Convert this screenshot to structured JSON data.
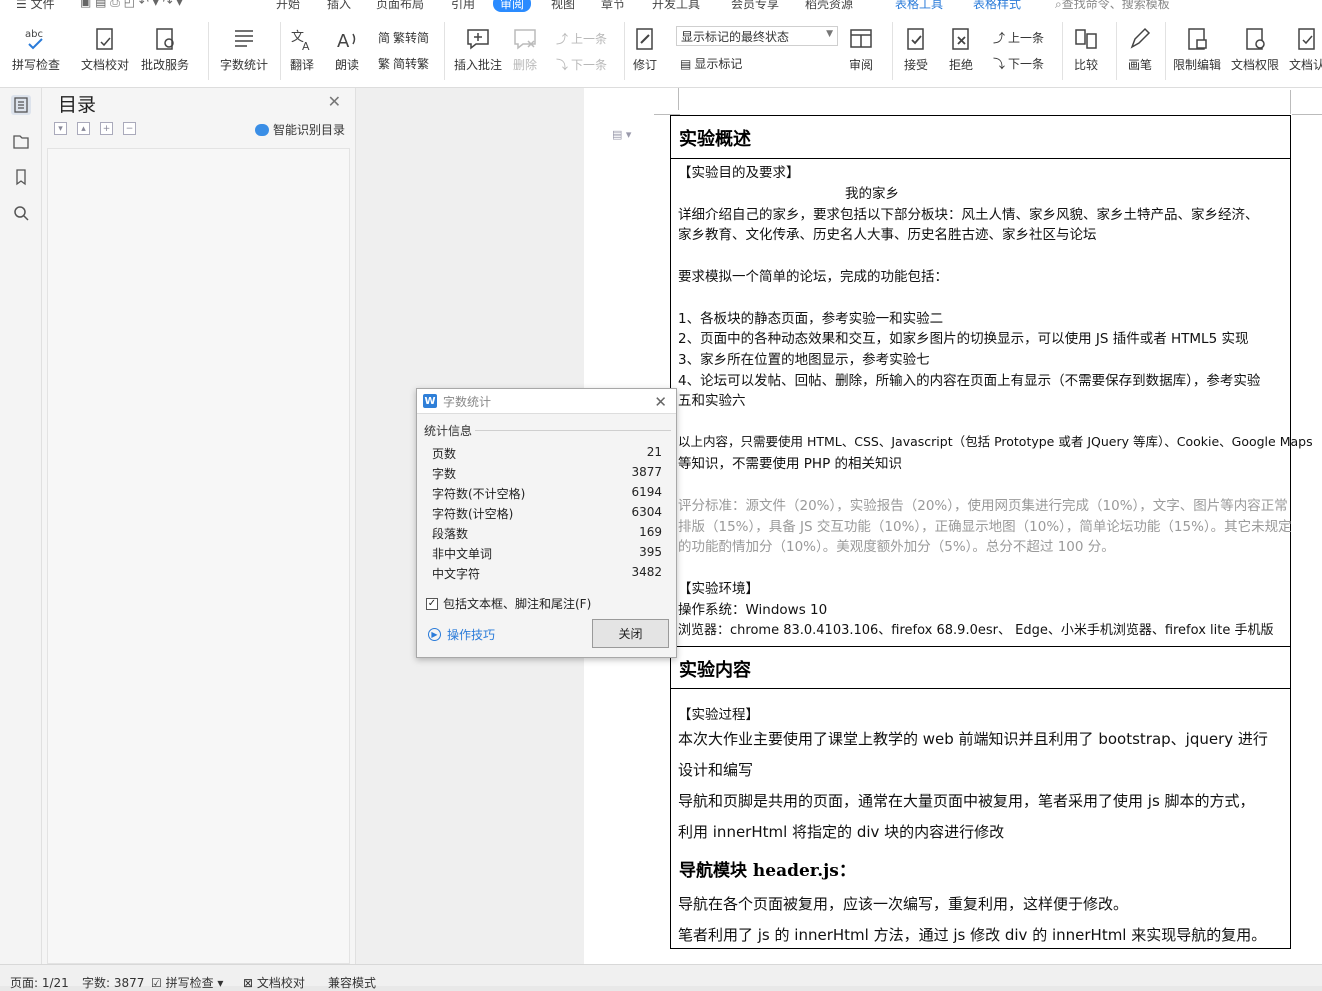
{
  "menubar": {
    "file_label": "文件",
    "tabs": [
      "开始",
      "插入",
      "页面布局",
      "引用",
      "审阅",
      "视图",
      "章节",
      "开发工具",
      "会员专享",
      "稻壳资源",
      "表格工具",
      "表格样式"
    ],
    "active_tab": "审阅",
    "search_placeholder": "查找命令、搜索模板"
  },
  "ribbon": {
    "spell_check": "拼写检查",
    "doc_proof": "文档校对",
    "revise_service": "批改服务",
    "word_count": "字数统计",
    "translate": "翻译",
    "read_aloud": "朗读",
    "trad_to_simp": "繁转简",
    "simp_to_trad": "简转繁",
    "insert_comment": "插入批注",
    "delete": "删除",
    "prev_comment": "上一条",
    "next_comment": "下一条",
    "track_changes": "修订",
    "markup_select": "显示标记的最终状态",
    "show_markup": "显示标记",
    "review": "审阅",
    "accept": "接受",
    "reject": "拒绝",
    "prev_change": "上一条",
    "next_change": "下一条",
    "compare": "比较",
    "pen": "画笔",
    "restrict_edit": "限制编辑",
    "doc_permission": "文档权限",
    "doc_more": "文档认"
  },
  "toc": {
    "title": "目录",
    "smart_label": "智能识别目录"
  },
  "document": {
    "section1_title": "实验概述",
    "purpose_heading": "【实验目的及要求】",
    "topic": "我的家乡",
    "line1": "详细介绍自己的家乡，要求包括以下部分板块：风土人情、家乡风貌、家乡土特产品、家乡经济、",
    "line2": "家乡教育、文化传承、历史名人大事、历史名胜古迹、家乡社区与论坛",
    "line3": "要求模拟一个简单的论坛，完成的功能包括：",
    "item1": "1、各板块的静态页面，参考实验一和实验二",
    "item2": "2、页面中的各种动态效果和交互，如家乡图片的切换显示，可以使用 JS 插件或者 HTML5 实现",
    "item3": "3、家乡所在位置的地图显示，参考实验七",
    "item4": "4、论坛可以发帖、回帖、删除，所输入的内容在页面上有显示（不需要保存到数据库），参考实验",
    "item4b": "五和实验六",
    "tech1": "以上内容，只需要使用 HTML、CSS、Javascript（包括 Prototype 或者 JQuery 等库）、Cookie、Google Maps",
    "tech2": "等知识，不需要使用 PHP 的相关知识",
    "score1": "评分标准：源文件（20%），实验报告（20%），使用网页集进行完成（10%），文字、图片等内容正常",
    "score2": "排版（15%），具备 JS 交互功能（10%），正确显示地图（10%），简单论坛功能（15%）。其它未规定",
    "score3": "的功能酌情加分（10%）。美观度额外加分（5%）。总分不超过 100 分。",
    "env_heading": "【实验环境】",
    "os": "操作系统：Windows 10",
    "browser": "浏览器：chrome 83.0.4103.106、firefox 68.9.0esr、 Edge、小米手机浏览器、firefox lite 手机版",
    "section2_title": "实验内容",
    "process_heading": "【实验过程】",
    "p1a": "本次大作业主要使用了课堂上教学的 web 前端知识并且利用了 bootstrap、jquery 进行",
    "p1b": "设计和编写",
    "p2a": "导航和页脚是共用的页面，通常在大量页面中被复用，笔者采用了使用 js 脚本的方式，",
    "p2b": "利用 innerHtml 将指定的 div 块的内容进行修改",
    "nav_heading": "导航模块 header.js：",
    "p3": "导航在各个页面被复用，应该一次编写，重复利用，这样便于修改。",
    "p4": "笔者利用了 js 的 innerHtml 方法，通过 js 修改 div 的 innerHtml 来实现导航的复用。"
  },
  "dialog": {
    "title": "字数统计",
    "section": "统计信息",
    "rows": [
      {
        "label": "页数",
        "value": "21"
      },
      {
        "label": "字数",
        "value": "3877"
      },
      {
        "label": "字符数(不计空格)",
        "value": "6194"
      },
      {
        "label": "字符数(计空格)",
        "value": "6304"
      },
      {
        "label": "段落数",
        "value": "169"
      },
      {
        "label": "非中文单词",
        "value": "395"
      },
      {
        "label": "中文字符",
        "value": "3482"
      }
    ],
    "checkbox_label": "包括文本框、脚注和尾注(F)",
    "checkbox_checked": true,
    "tips_label": "操作技巧",
    "close_label": "关闭"
  },
  "statusbar": {
    "page": "页面: 1/21",
    "words": "字数: 3877",
    "spell": "拼写检查",
    "proof": "文档校对",
    "compat": "兼容模式"
  },
  "colors": {
    "accent": "#2a8bff",
    "table_tool_text": "#2a7bd9",
    "gray_text": "#9a9a9a"
  }
}
